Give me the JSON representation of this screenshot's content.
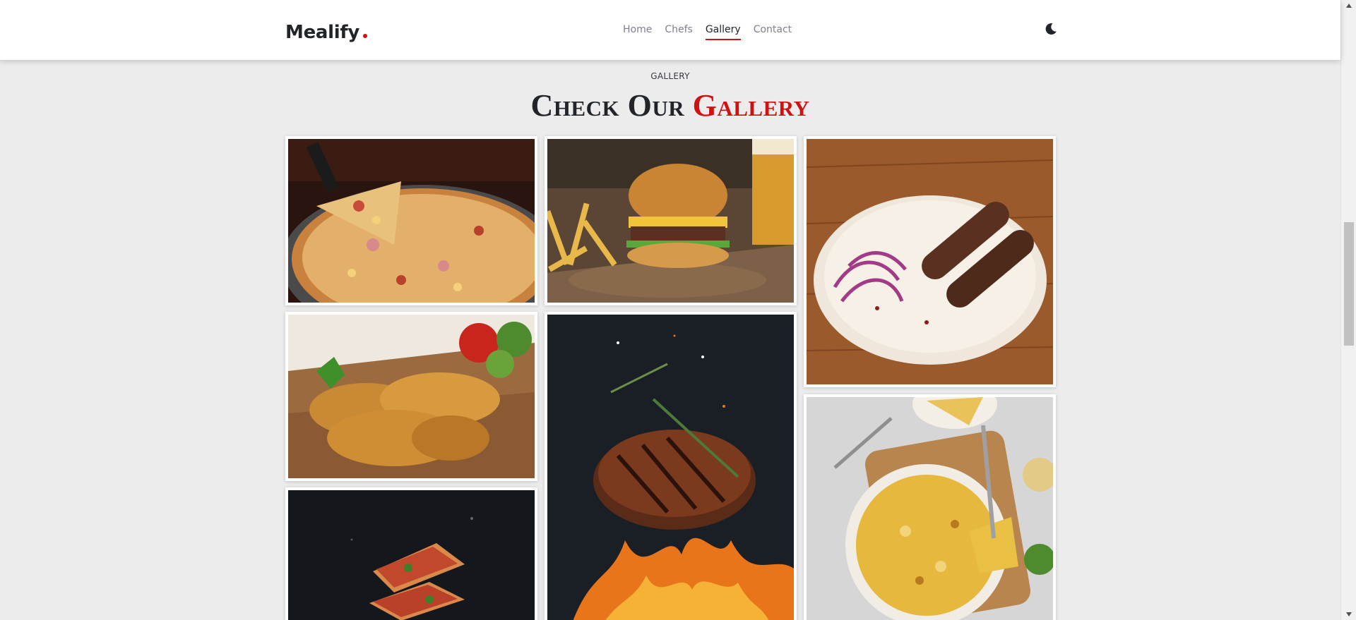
{
  "brand": {
    "name": "Mealify",
    "accent_color": "#ce1212"
  },
  "nav": {
    "items": [
      {
        "label": "Home",
        "active": false
      },
      {
        "label": "Chefs",
        "active": false
      },
      {
        "label": "Gallery",
        "active": true
      },
      {
        "label": "Contact",
        "active": false
      }
    ]
  },
  "theme_toggle": {
    "icon": "moon-icon"
  },
  "section": {
    "subtitle": "GALLERY",
    "title_prefix": "Check Our",
    "title_accent": "Gallery"
  },
  "gallery": {
    "images": [
      {
        "icon": "pizza-photo"
      },
      {
        "icon": "burger-photo"
      },
      {
        "icon": "kebab-photo"
      },
      {
        "icon": "fried-chicken-photo"
      },
      {
        "icon": "grilled-steak-photo"
      },
      {
        "icon": "flying-pizza-photo"
      },
      {
        "icon": "omelette-photo"
      }
    ]
  }
}
